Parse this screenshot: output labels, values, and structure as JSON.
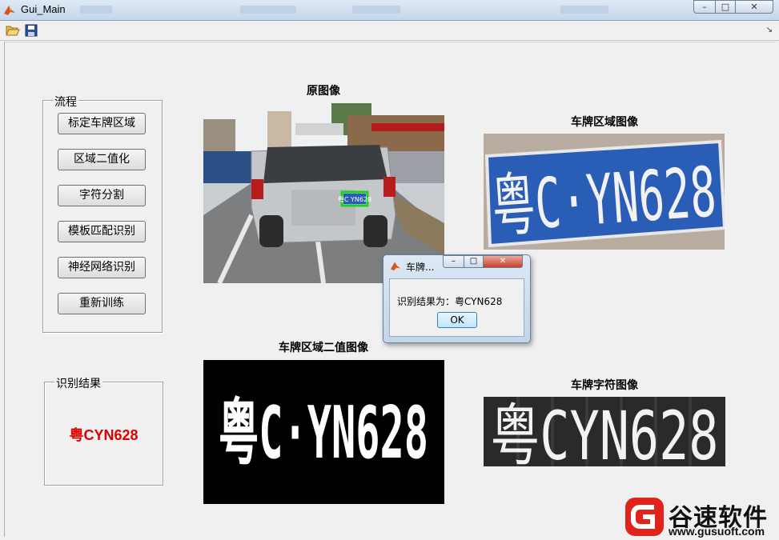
{
  "window": {
    "title": "Gui_Main",
    "min": "–",
    "max": "□",
    "close": "✕"
  },
  "toolbar": {
    "open_icon": "folder-open-icon",
    "save_icon": "save-icon",
    "corner": "↘"
  },
  "flow_panel": {
    "title": "流程",
    "buttons": [
      "标定车牌区域",
      "区域二值化",
      "字符分割",
      "模板匹配识别",
      "神经网络识别",
      "重新训练"
    ]
  },
  "result_panel": {
    "title": "识别结果",
    "value": "粤CYN628"
  },
  "images": {
    "original_label": "原图像",
    "plate_label": "车牌区域图像",
    "binary_label": "车牌区域二值图像",
    "chars_label": "车牌字符图像",
    "plate_text": "粤C·YN628",
    "small_plate_text": "粤C YN628",
    "char_text": "粤CYN628"
  },
  "dialog": {
    "title": "车牌...",
    "message": "识别结果为：粤CYN628",
    "ok": "OK"
  },
  "watermark": {
    "name": "谷速软件",
    "url": "www.gusuoft.com"
  },
  "colors": {
    "result": "#e00000",
    "plate_blue": "#2a5db5",
    "accent_red": "#e0231b"
  }
}
